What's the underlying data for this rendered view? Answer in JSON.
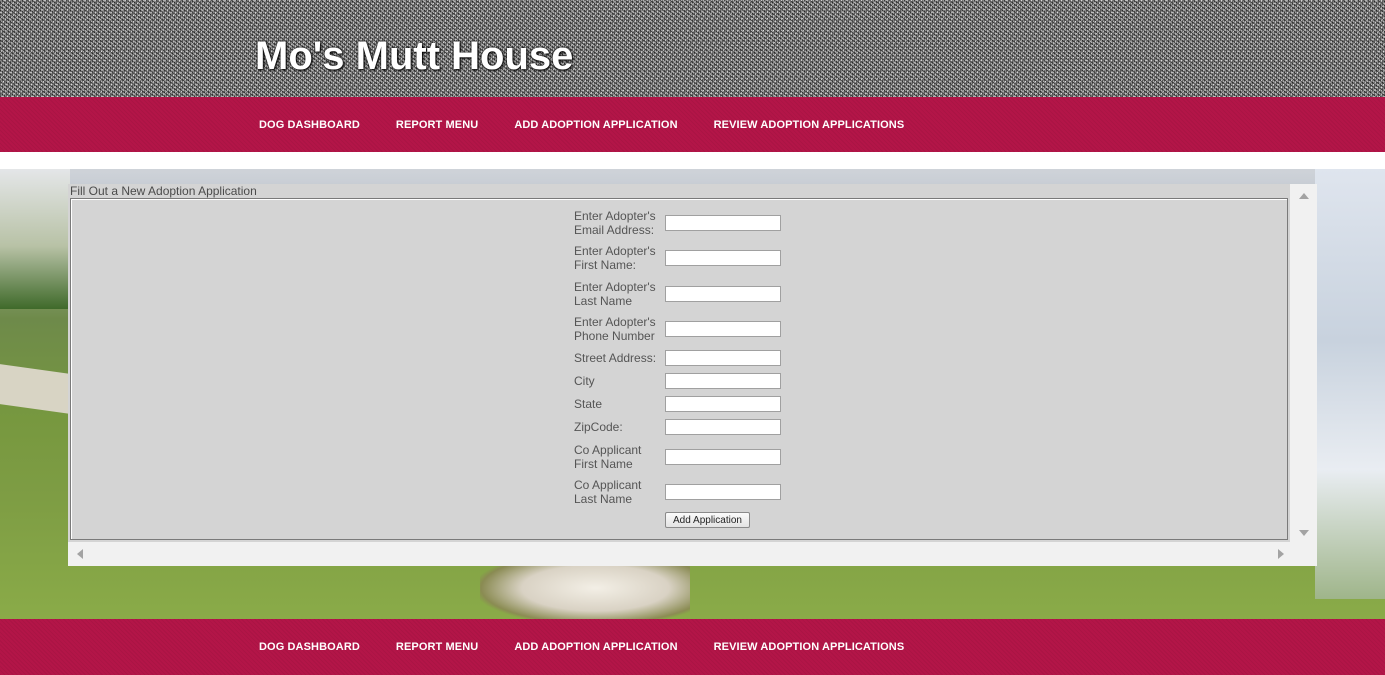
{
  "header": {
    "title": "Mo's Mutt House"
  },
  "nav": {
    "items": [
      {
        "label": "DOG DASHBOARD"
      },
      {
        "label": "REPORT MENU"
      },
      {
        "label": "ADD ADOPTION APPLICATION"
      },
      {
        "label": "REVIEW ADOPTION APPLICATIONS"
      }
    ]
  },
  "footer_nav": {
    "items": [
      {
        "label": "DOG DASHBOARD"
      },
      {
        "label": "REPORT MENU"
      },
      {
        "label": "ADD ADOPTION APPLICATION"
      },
      {
        "label": "REVIEW ADOPTION APPLICATIONS"
      }
    ]
  },
  "form": {
    "legend": "Fill Out a New Adoption Application",
    "fields": [
      {
        "label": "Enter Adopter's Email Address:",
        "value": ""
      },
      {
        "label": "Enter Adopter's First Name:",
        "value": ""
      },
      {
        "label": "Enter Adopter's Last Name",
        "value": ""
      },
      {
        "label": "Enter Adopter's Phone Number",
        "value": ""
      },
      {
        "label": "Street Address:",
        "value": ""
      },
      {
        "label": "City",
        "value": ""
      },
      {
        "label": "State",
        "value": ""
      },
      {
        "label": "ZipCode:",
        "value": ""
      },
      {
        "label": "Co Applicant First Name",
        "value": ""
      },
      {
        "label": "Co Applicant Last Name",
        "value": ""
      }
    ],
    "submit_label": "Add Application"
  },
  "colors": {
    "nav_background": "#b31548",
    "nav_text": "#ffffff",
    "form_background": "#d4d4d4",
    "title_text": "#ffffff"
  },
  "icons": {
    "scroll_up": "triangle-up",
    "scroll_down": "triangle-down",
    "scroll_left": "triangle-left",
    "scroll_right": "triangle-right"
  }
}
